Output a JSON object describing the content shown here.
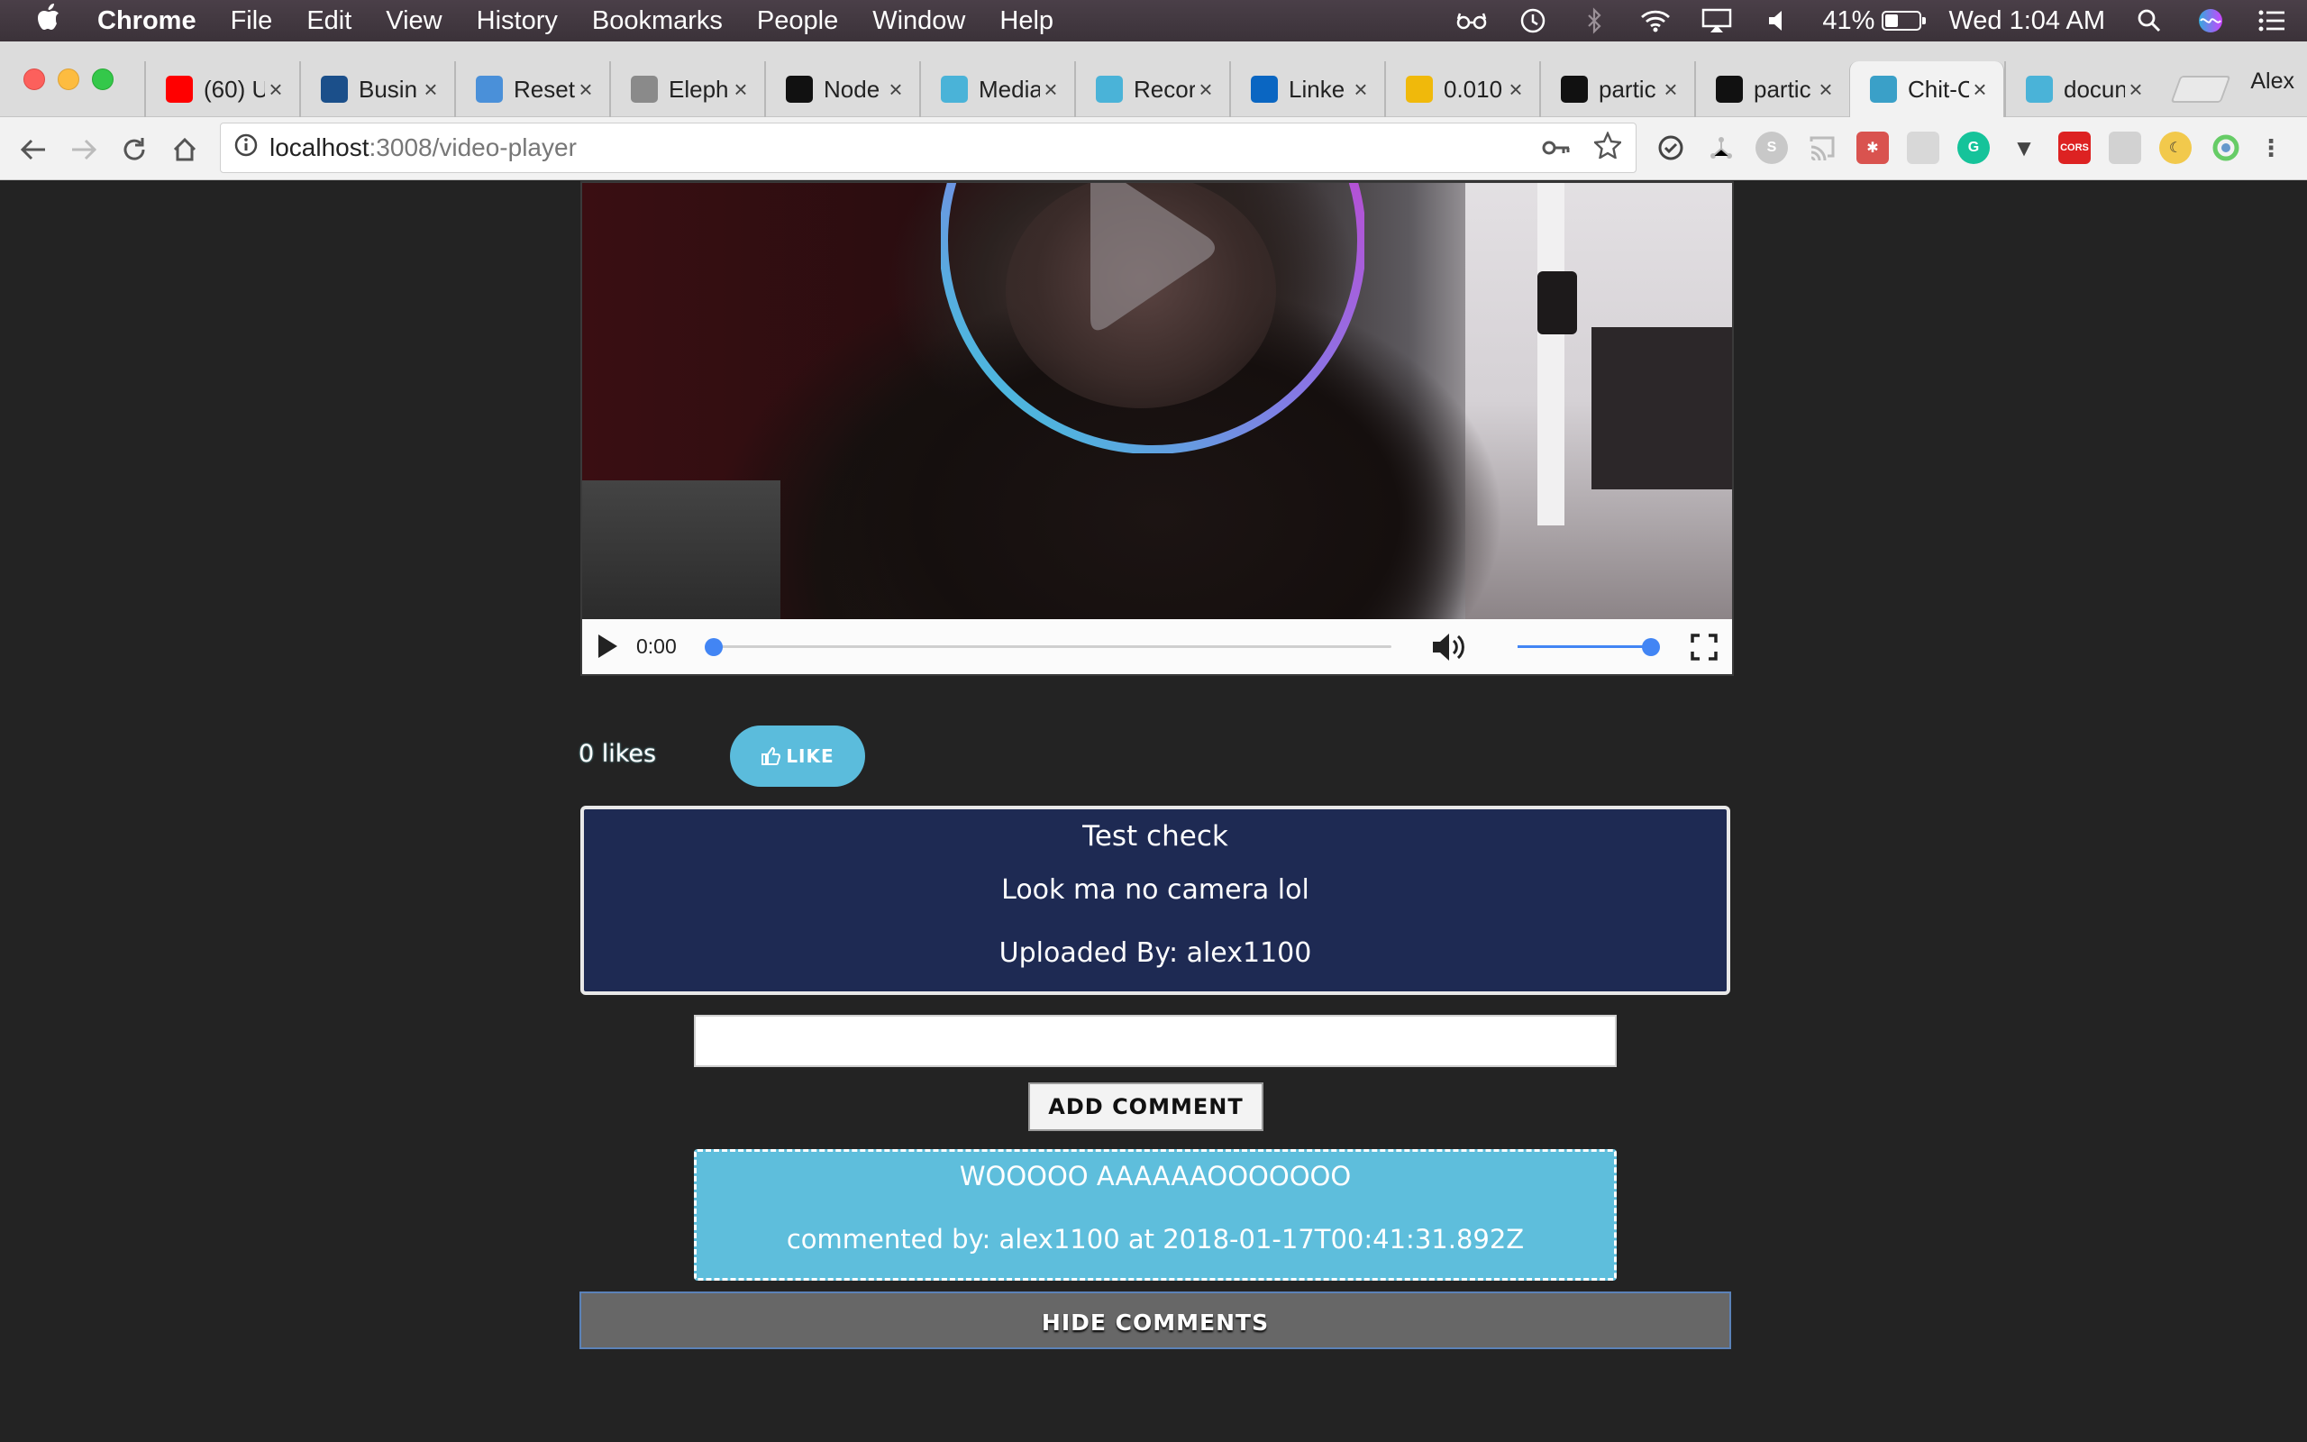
{
  "menubar": {
    "app_name": "Chrome",
    "items": [
      "File",
      "Edit",
      "View",
      "History",
      "Bookmarks",
      "People",
      "Window",
      "Help"
    ],
    "battery": "41%",
    "clock": "Wed 1:04 AM"
  },
  "browser": {
    "tabs": [
      {
        "title": "(60) U",
        "favicon": "youtube-icon",
        "color": "#ff0000"
      },
      {
        "title": "Busin",
        "favicon": "business-insider-icon",
        "color": "#1b4f8a"
      },
      {
        "title": "Reset",
        "favicon": "dots-icon",
        "color": "#4a90d9"
      },
      {
        "title": "Eleph",
        "favicon": "elephant-icon",
        "color": "#8a8a8a"
      },
      {
        "title": "Node",
        "favicon": "github-icon",
        "color": "#111111"
      },
      {
        "title": "Media",
        "favicon": "bird-icon",
        "color": "#4ab3d8"
      },
      {
        "title": "Recor",
        "favicon": "bird-icon",
        "color": "#4ab3d8"
      },
      {
        "title": "Linke",
        "favicon": "linkedin-icon",
        "color": "#0a66c2"
      },
      {
        "title": "0.010",
        "favicon": "binance-icon",
        "color": "#f0b90b"
      },
      {
        "title": "partic",
        "favicon": "square-icon",
        "color": "#111111"
      },
      {
        "title": "partic",
        "favicon": "codepen-icon",
        "color": "#111111"
      },
      {
        "title": "Chit-C",
        "favicon": "chit-chat-icon",
        "color": "#3aa0c8"
      },
      {
        "title": "docun",
        "favicon": "bird-icon",
        "color": "#4ab3d8"
      }
    ],
    "active_tab_index": 11,
    "profile_name": "Alex",
    "url_host": "localhost",
    "url_path": ":3008/video-player"
  },
  "player": {
    "current_time": "0:00",
    "progress": 0,
    "volume": 1.0
  },
  "likes": {
    "count_label": "0 likes",
    "button_label": "Like"
  },
  "video_info": {
    "title": "Test check",
    "description": "Look ma no camera lol",
    "uploader": "Uploaded By: alex1100"
  },
  "comment_form": {
    "input_value": "",
    "button_label": "Add Comment"
  },
  "comments": [
    {
      "text": "WOOOOO AAAAAAOOOOOOO",
      "meta": "commented by: alex1100 at 2018-01-17T00:41:31.892Z"
    }
  ],
  "hide_comments_label": "Hide Comments",
  "colors": {
    "page_background": "#232323",
    "info_card": "#1e2a53",
    "accent_blue": "#5ebedc",
    "player_blue": "#4285f4"
  }
}
